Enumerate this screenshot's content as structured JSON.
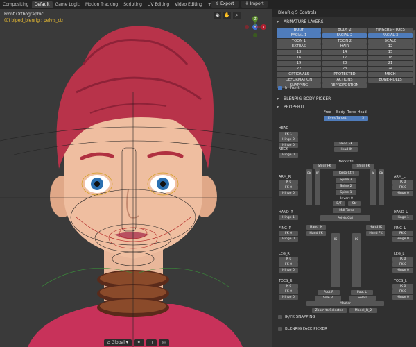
{
  "topbar": {
    "tabs": [
      "Compositing",
      "Default",
      "Game Logic",
      "Motion Tracking",
      "Scripting",
      "UV Editing",
      "Video Editing",
      "+"
    ],
    "export_label": "Export",
    "import_label": "Import"
  },
  "viewport": {
    "title": "Front Orthographic",
    "subtitle": "(0) biped_blenrig : pelvis_ctrl",
    "gizmo_axes": {
      "x": "X",
      "y": "Y",
      "z": "Z"
    },
    "bottom": {
      "orientation": "Global"
    }
  },
  "panel": {
    "header": "BlenRig 5 Controls",
    "armature_layers": "ARMATURE LAYERS",
    "layers": [
      {
        "label": "BODY",
        "on": true
      },
      {
        "label": "BODY 2",
        "on": false
      },
      {
        "label": "FINGERS - TOES",
        "on": false
      },
      {
        "label": "FACIAL 1",
        "on": true
      },
      {
        "label": "FACIAL 2",
        "on": true
      },
      {
        "label": "FACIAL 3",
        "on": true
      },
      {
        "label": "TOON 1",
        "on": false
      },
      {
        "label": "TOON 2",
        "on": false
      },
      {
        "label": "SCALE",
        "on": false
      },
      {
        "label": "EXTRAS",
        "on": false
      },
      {
        "label": "HAIR",
        "on": false
      },
      {
        "label": "12",
        "on": false
      },
      {
        "label": "13",
        "on": false
      },
      {
        "label": "14",
        "on": false
      },
      {
        "label": "15",
        "on": false
      },
      {
        "label": "16",
        "on": false
      },
      {
        "label": "17",
        "on": false
      },
      {
        "label": "18",
        "on": false
      },
      {
        "label": "19",
        "on": false
      },
      {
        "label": "20",
        "on": false
      },
      {
        "label": "21",
        "on": false
      },
      {
        "label": "22",
        "on": false
      },
      {
        "label": "23",
        "on": false
      },
      {
        "label": "24",
        "on": false
      },
      {
        "label": "OPTIONALS",
        "on": false
      },
      {
        "label": "PROTECTED",
        "on": false
      },
      {
        "label": "MECH",
        "on": false
      },
      {
        "label": "DEFORMATION",
        "on": false
      },
      {
        "label": "ACTIONS",
        "on": false
      },
      {
        "label": "BONE-ROLLS",
        "on": false
      },
      {
        "label": "SNAPPING",
        "on": false
      },
      {
        "label": "REPROPORTION",
        "on": false
      }
    ],
    "in_front": "In Front",
    "body_picker": "BLENRIG BODY PICKER",
    "properties": "PROPERTI...",
    "picker_modes": [
      "Free",
      "Body",
      "Torso Head"
    ],
    "eyes_target": "Eyes Target",
    "eyes_target_value": "5",
    "snapping": "IK/FK SNAPPING",
    "face_picker": "BLENRIG FACE PICKER"
  },
  "picker": {
    "head": "HEAD",
    "fk1": "FK 1",
    "hinge0": "Hinge 0",
    "hinge_0b": "Hinge 0",
    "neck": "NECK",
    "neck_hinge": "Hinge 0",
    "head_fk": "Head FK",
    "head_ik": "Head IK",
    "neck_ctrl": "Neck Ctrl",
    "shldr_fk_l": "Shldr FK",
    "shldr_fk_r": "Shldr FK",
    "torso_ctrl": "Torso Ctrl",
    "spine3": "Spine 3",
    "spine2": "Spine 2",
    "spine1": "Spine 1",
    "invert": "Invert 0",
    "b_t": "B/T",
    "str": "Str",
    "mdl_torso": "Mdl Torso",
    "pelvis_ctrl": "Pelvis Ctrl",
    "arm_r": "ARM_R",
    "arm_l": "ARM_L",
    "ik0": "IK 0",
    "fk0": "FK 0",
    "hand_r": "HAND_R",
    "hand_l": "HAND_L",
    "hinge1": "Hinge 1",
    "fing_r": "FING_R",
    "fing_l": "FING_L",
    "hand_ik": "Hand IK",
    "hand_fk": "Hand FK",
    "leg_r": "LEG_R",
    "leg_l": "LEG_L",
    "toes_r": "TOES_R",
    "toes_l": "TOES_L",
    "foot_r": "Foot R",
    "foot_l": "Foot L",
    "sole_r": "Sole R",
    "sole_l": "Sole L",
    "master": "Master",
    "zoom": "Zoom to Selected",
    "model": "Model_R_2",
    "ik_letter": "IK",
    "fk_letter": "FK"
  }
}
